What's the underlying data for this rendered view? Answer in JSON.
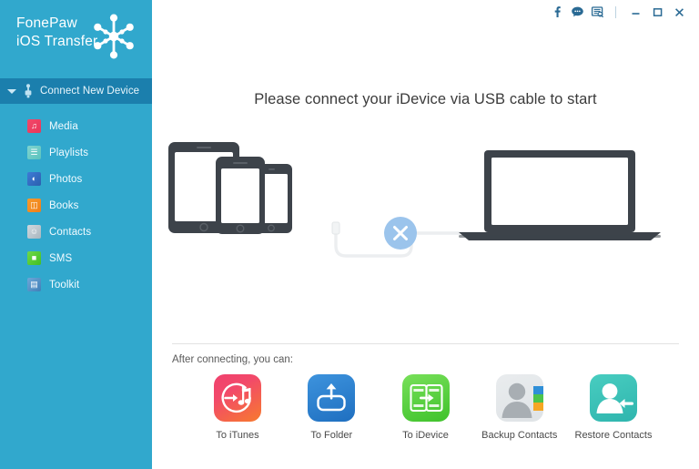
{
  "app": {
    "brand_line1": "FonePaw",
    "brand_line2": "iOS Transfer",
    "logo_icon": "snowflake-icon",
    "sidebar_color": "#31a8cd",
    "accent_color": "#1b7fad"
  },
  "titlebar": {
    "icons": [
      {
        "name": "facebook-icon",
        "glyph": "f"
      },
      {
        "name": "chat-bubble-icon",
        "glyph": "●"
      },
      {
        "name": "feedback-icon",
        "glyph": "☰"
      }
    ],
    "minimize_label": "–",
    "maximize_label": "□",
    "close_label": "✕"
  },
  "sidebar": {
    "connect": {
      "label": "Connect New Device",
      "caret_icon": "chevron-down-icon",
      "device_icon": "usb-connector-icon"
    },
    "items": [
      {
        "label": "Media",
        "icon": "media-icon",
        "glyph": "♫"
      },
      {
        "label": "Playlists",
        "icon": "playlists-icon",
        "glyph": "☰"
      },
      {
        "label": "Photos",
        "icon": "photos-icon",
        "glyph": "◐"
      },
      {
        "label": "Books",
        "icon": "books-icon",
        "glyph": "◫"
      },
      {
        "label": "Contacts",
        "icon": "contacts-icon",
        "glyph": "☺"
      },
      {
        "label": "SMS",
        "icon": "sms-icon",
        "glyph": "■"
      },
      {
        "label": "Toolkit",
        "icon": "toolkit-icon",
        "glyph": "▤"
      }
    ]
  },
  "main": {
    "heading": "Please connect your iDevice via USB cable to start",
    "illustration": {
      "name": "devices-disconnected-illustration",
      "device_color": "#3d434a",
      "status_badge_color": "#9bc4ec",
      "status_badge_icon": "close-x-icon"
    },
    "after_label": "After connecting, you can:",
    "actions": [
      {
        "label": "To iTunes",
        "icon": "to-itunes-icon"
      },
      {
        "label": "To Folder",
        "icon": "to-folder-icon"
      },
      {
        "label": "To iDevice",
        "icon": "to-idevice-icon"
      },
      {
        "label": "Backup Contacts",
        "icon": "backup-contacts-icon"
      },
      {
        "label": "Restore Contacts",
        "icon": "restore-contacts-icon"
      }
    ]
  }
}
